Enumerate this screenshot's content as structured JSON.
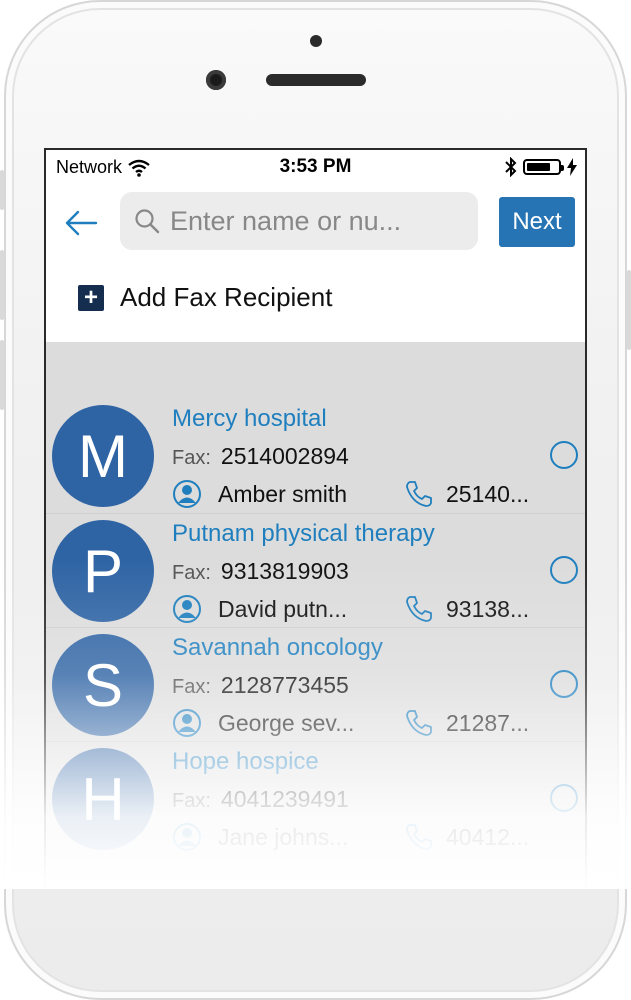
{
  "status_bar": {
    "carrier": "Network",
    "time": "3:53 PM"
  },
  "header": {
    "search_placeholder": "Enter name or nu...",
    "next_label": "Next"
  },
  "add_recipient": {
    "plus": "+",
    "label": "Add Fax Recipient"
  },
  "fax_prefix": "Fax:",
  "contacts": [
    {
      "initial": "M",
      "name": "Mercy hospital",
      "fax": "2514002894",
      "contact": "Amber smith",
      "phone": "25140..."
    },
    {
      "initial": "P",
      "name": "Putnam physical therapy",
      "fax": "9313819903",
      "contact": "David putn...",
      "phone": "93138..."
    },
    {
      "initial": "S",
      "name": "Savannah oncology",
      "fax": "2128773455",
      "contact": "George sev...",
      "phone": "21287..."
    },
    {
      "initial": "H",
      "name": "Hope hospice",
      "fax": "4041239491",
      "contact": "Jane johns...",
      "phone": "40412..."
    }
  ],
  "colors": {
    "accent": "#1f7fbe",
    "button": "#2674b4",
    "avatar": "#2f64a4"
  }
}
